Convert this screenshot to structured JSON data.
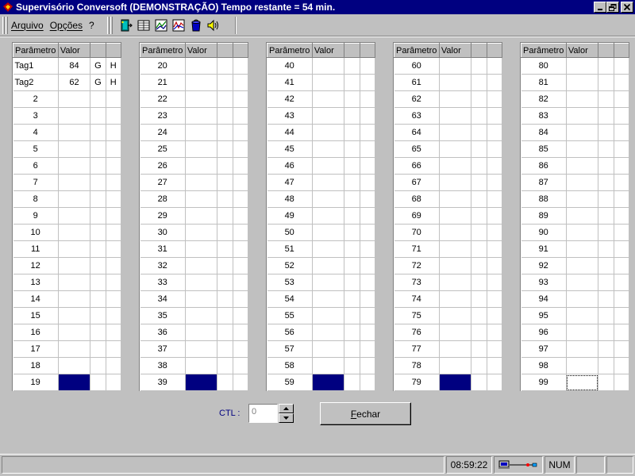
{
  "window": {
    "title": "Supervisório Conversoft (DEMONSTRAÇÃO) Tempo restante = 54 min."
  },
  "menu": {
    "arquivo": "Arquivo",
    "opcoes": "Opções",
    "help": "?"
  },
  "toolbar": {
    "icons": [
      "door-exit-icon",
      "table-view-icon",
      "chart-icon",
      "trend-chart-icon",
      "bucket-icon",
      "speaker-icon"
    ]
  },
  "grid_headers": {
    "param": "Parâmetro",
    "value": "Valor"
  },
  "grids": [
    {
      "rows": [
        {
          "param": "Tag1",
          "value": "84",
          "c3": "G",
          "c4": "H"
        },
        {
          "param": "Tag2",
          "value": "62",
          "c3": "G",
          "c4": "H"
        },
        {
          "param": "2",
          "value": "",
          "c3": "",
          "c4": ""
        },
        {
          "param": "3",
          "value": "",
          "c3": "",
          "c4": ""
        },
        {
          "param": "4",
          "value": "",
          "c3": "",
          "c4": ""
        },
        {
          "param": "5",
          "value": "",
          "c3": "",
          "c4": ""
        },
        {
          "param": "6",
          "value": "",
          "c3": "",
          "c4": ""
        },
        {
          "param": "7",
          "value": "",
          "c3": "",
          "c4": ""
        },
        {
          "param": "8",
          "value": "",
          "c3": "",
          "c4": ""
        },
        {
          "param": "9",
          "value": "",
          "c3": "",
          "c4": ""
        },
        {
          "param": "10",
          "value": "",
          "c3": "",
          "c4": ""
        },
        {
          "param": "11",
          "value": "",
          "c3": "",
          "c4": ""
        },
        {
          "param": "12",
          "value": "",
          "c3": "",
          "c4": ""
        },
        {
          "param": "13",
          "value": "",
          "c3": "",
          "c4": ""
        },
        {
          "param": "14",
          "value": "",
          "c3": "",
          "c4": ""
        },
        {
          "param": "15",
          "value": "",
          "c3": "",
          "c4": ""
        },
        {
          "param": "16",
          "value": "",
          "c3": "",
          "c4": ""
        },
        {
          "param": "17",
          "value": "",
          "c3": "",
          "c4": ""
        },
        {
          "param": "18",
          "value": "",
          "c3": "",
          "c4": ""
        },
        {
          "param": "19",
          "value": "",
          "c3": "",
          "c4": ""
        }
      ]
    },
    {
      "rows": [
        {
          "param": "20",
          "value": ""
        },
        {
          "param": "21",
          "value": ""
        },
        {
          "param": "22",
          "value": ""
        },
        {
          "param": "23",
          "value": ""
        },
        {
          "param": "24",
          "value": ""
        },
        {
          "param": "25",
          "value": ""
        },
        {
          "param": "26",
          "value": ""
        },
        {
          "param": "27",
          "value": ""
        },
        {
          "param": "28",
          "value": ""
        },
        {
          "param": "29",
          "value": ""
        },
        {
          "param": "30",
          "value": ""
        },
        {
          "param": "31",
          "value": ""
        },
        {
          "param": "32",
          "value": ""
        },
        {
          "param": "33",
          "value": ""
        },
        {
          "param": "34",
          "value": ""
        },
        {
          "param": "35",
          "value": ""
        },
        {
          "param": "36",
          "value": ""
        },
        {
          "param": "37",
          "value": ""
        },
        {
          "param": "38",
          "value": ""
        },
        {
          "param": "39",
          "value": ""
        }
      ]
    },
    {
      "rows": [
        {
          "param": "40",
          "value": ""
        },
        {
          "param": "41",
          "value": ""
        },
        {
          "param": "42",
          "value": ""
        },
        {
          "param": "43",
          "value": ""
        },
        {
          "param": "44",
          "value": ""
        },
        {
          "param": "45",
          "value": ""
        },
        {
          "param": "46",
          "value": ""
        },
        {
          "param": "47",
          "value": ""
        },
        {
          "param": "48",
          "value": ""
        },
        {
          "param": "49",
          "value": ""
        },
        {
          "param": "50",
          "value": ""
        },
        {
          "param": "51",
          "value": ""
        },
        {
          "param": "52",
          "value": ""
        },
        {
          "param": "53",
          "value": ""
        },
        {
          "param": "54",
          "value": ""
        },
        {
          "param": "55",
          "value": ""
        },
        {
          "param": "56",
          "value": ""
        },
        {
          "param": "57",
          "value": ""
        },
        {
          "param": "58",
          "value": ""
        },
        {
          "param": "59",
          "value": ""
        }
      ]
    },
    {
      "rows": [
        {
          "param": "60",
          "value": ""
        },
        {
          "param": "61",
          "value": ""
        },
        {
          "param": "62",
          "value": ""
        },
        {
          "param": "63",
          "value": ""
        },
        {
          "param": "64",
          "value": ""
        },
        {
          "param": "65",
          "value": ""
        },
        {
          "param": "66",
          "value": ""
        },
        {
          "param": "67",
          "value": ""
        },
        {
          "param": "68",
          "value": ""
        },
        {
          "param": "69",
          "value": ""
        },
        {
          "param": "70",
          "value": ""
        },
        {
          "param": "71",
          "value": ""
        },
        {
          "param": "72",
          "value": ""
        },
        {
          "param": "73",
          "value": ""
        },
        {
          "param": "74",
          "value": ""
        },
        {
          "param": "75",
          "value": ""
        },
        {
          "param": "76",
          "value": ""
        },
        {
          "param": "77",
          "value": ""
        },
        {
          "param": "78",
          "value": ""
        },
        {
          "param": "79",
          "value": ""
        }
      ]
    },
    {
      "rows": [
        {
          "param": "80",
          "value": ""
        },
        {
          "param": "81",
          "value": ""
        },
        {
          "param": "82",
          "value": ""
        },
        {
          "param": "83",
          "value": ""
        },
        {
          "param": "84",
          "value": ""
        },
        {
          "param": "85",
          "value": ""
        },
        {
          "param": "86",
          "value": ""
        },
        {
          "param": "87",
          "value": ""
        },
        {
          "param": "88",
          "value": ""
        },
        {
          "param": "89",
          "value": ""
        },
        {
          "param": "90",
          "value": ""
        },
        {
          "param": "91",
          "value": ""
        },
        {
          "param": "92",
          "value": ""
        },
        {
          "param": "93",
          "value": ""
        },
        {
          "param": "94",
          "value": ""
        },
        {
          "param": "95",
          "value": ""
        },
        {
          "param": "96",
          "value": ""
        },
        {
          "param": "97",
          "value": ""
        },
        {
          "param": "98",
          "value": ""
        },
        {
          "param": "99",
          "value": ""
        }
      ]
    }
  ],
  "controls": {
    "ctl_label": "CTL :",
    "ctl_value": "0",
    "close_button": "Fechar"
  },
  "status": {
    "time": "08:59:22",
    "num": "NUM"
  },
  "colors": {
    "selection": "#000080",
    "titlebar": "#000080",
    "face": "#c0c0c0"
  }
}
